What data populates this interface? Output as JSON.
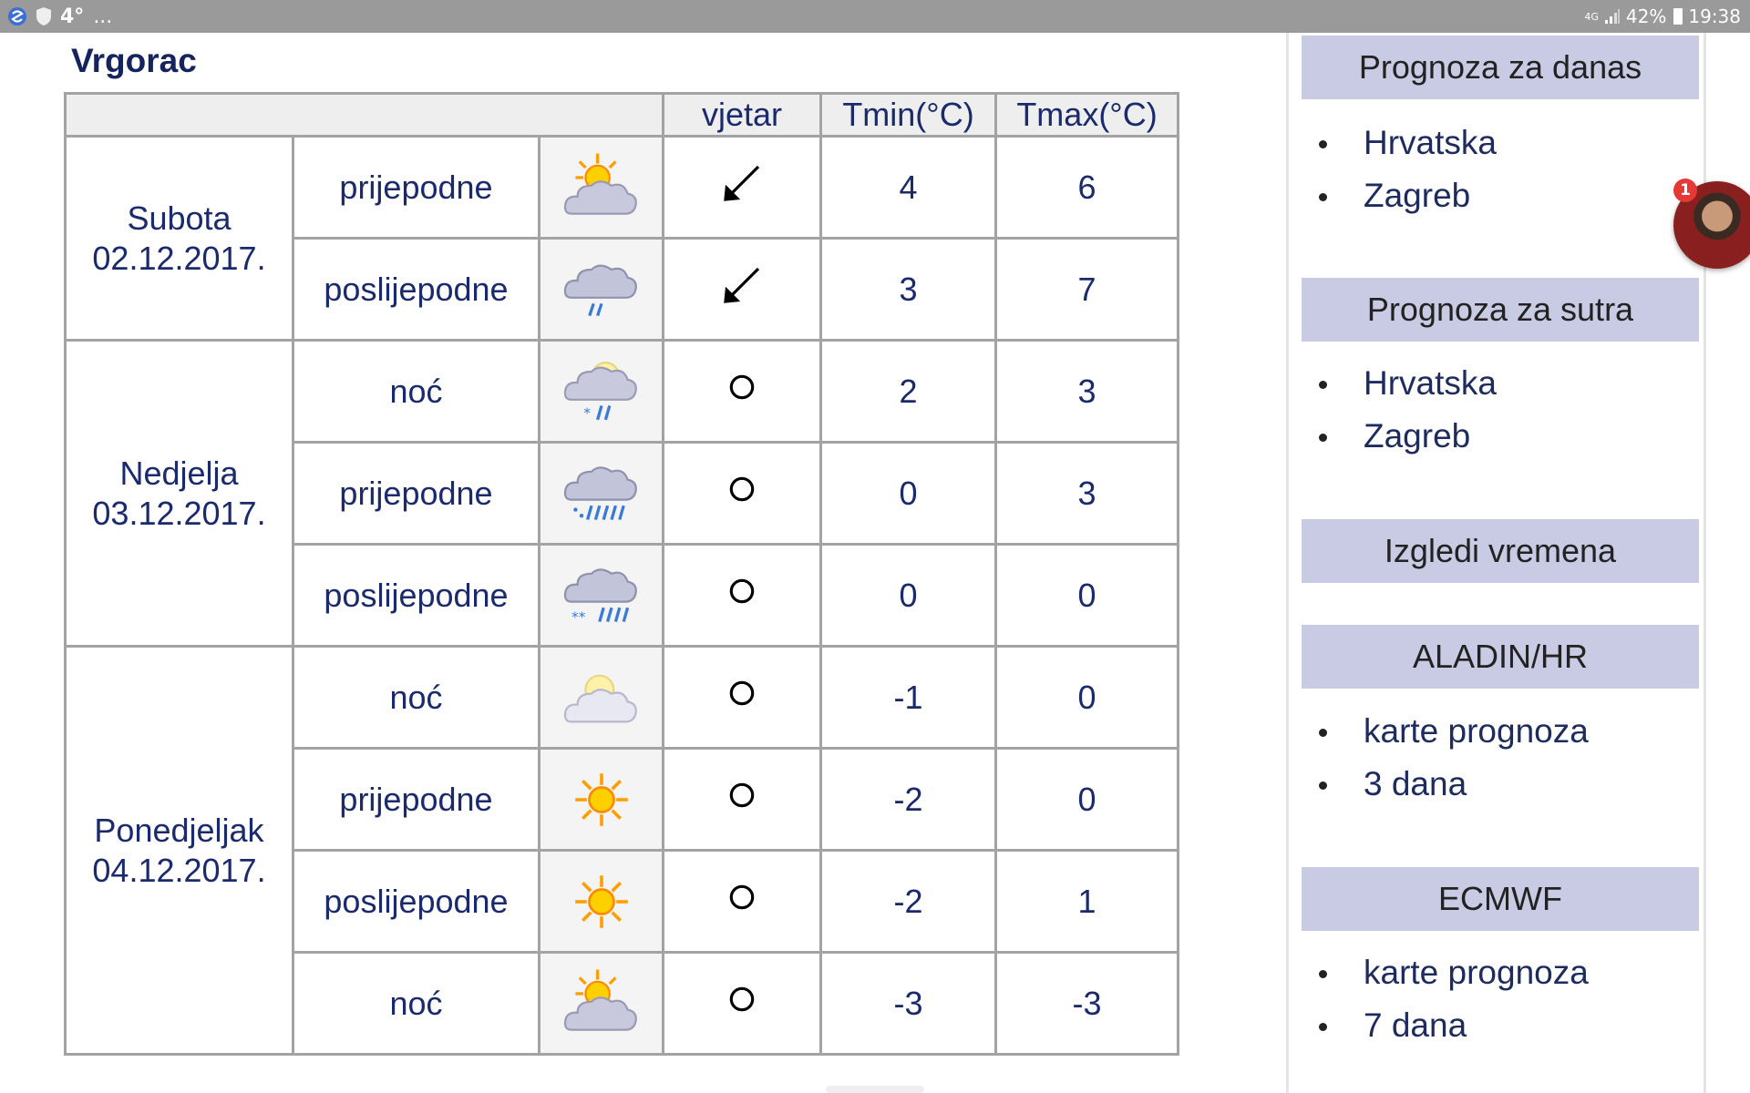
{
  "status_bar": {
    "temperature": "4°",
    "overflow": "...",
    "network": "4G",
    "battery": "42%",
    "time": "19:38"
  },
  "page": {
    "title": "Vrgorac"
  },
  "table": {
    "headers": {
      "blank": "",
      "wind": "vjetar",
      "tmin": "Tmin(°C)",
      "tmax": "Tmax(°C)"
    },
    "days": [
      {
        "name": "Subota",
        "date": "02.12.2017."
      },
      {
        "name": "Nedjelja",
        "date": "03.12.2017."
      },
      {
        "name": "Ponedjeljak",
        "date": "04.12.2017."
      }
    ],
    "rows": [
      {
        "period": "prijepodne",
        "icon": "partly-cloudy-icon",
        "wind": "sw-arrow-icon",
        "tmin": "4",
        "tmax": "6"
      },
      {
        "period": "poslijepodne",
        "icon": "cloud-rain-icon",
        "wind": "sw-arrow-icon",
        "tmin": "3",
        "tmax": "7"
      },
      {
        "period": "noć",
        "icon": "partly-cloudy-rain-snow-icon",
        "wind": "calm-circle-icon",
        "tmin": "2",
        "tmax": "3"
      },
      {
        "period": "prijepodne",
        "icon": "cloud-heavy-rain-icon",
        "wind": "calm-circle-icon",
        "tmin": "0",
        "tmax": "3"
      },
      {
        "period": "poslijepodne",
        "icon": "cloud-sleet-icon",
        "wind": "calm-circle-icon",
        "tmin": "0",
        "tmax": "0"
      },
      {
        "period": "noć",
        "icon": "partly-cloudy-icon",
        "wind": "calm-circle-icon",
        "tmin": "-1",
        "tmax": "0"
      },
      {
        "period": "prijepodne",
        "icon": "sun-icon",
        "wind": "calm-circle-icon",
        "tmin": "-2",
        "tmax": "0"
      },
      {
        "period": "poslijepodne",
        "icon": "sun-icon",
        "wind": "calm-circle-icon",
        "tmin": "-2",
        "tmax": "1"
      },
      {
        "period": "noć",
        "icon": "partly-cloudy-icon",
        "wind": "calm-circle-icon",
        "tmin": "-3",
        "tmax": "-3"
      }
    ]
  },
  "sidebar": {
    "sections": [
      {
        "title": "Prognoza za danas",
        "items": [
          "Hrvatska",
          "Zagreb"
        ]
      },
      {
        "title": "Prognoza za sutra",
        "items": [
          "Hrvatska",
          "Zagreb"
        ]
      },
      {
        "title": "Izgledi vremena",
        "items": []
      },
      {
        "title": "ALADIN/HR",
        "items": [
          "karte prognoza",
          "3 dana"
        ]
      },
      {
        "title": "ECMWF",
        "items": [
          "karte prognoza",
          "7 dana"
        ]
      }
    ]
  },
  "chat_bubble": {
    "badge_count": "1"
  },
  "colors": {
    "accent_header": "#c9cae4",
    "text": "#1a2a6c",
    "status_bar": "#9a9a9a",
    "badge": "#e53935"
  }
}
